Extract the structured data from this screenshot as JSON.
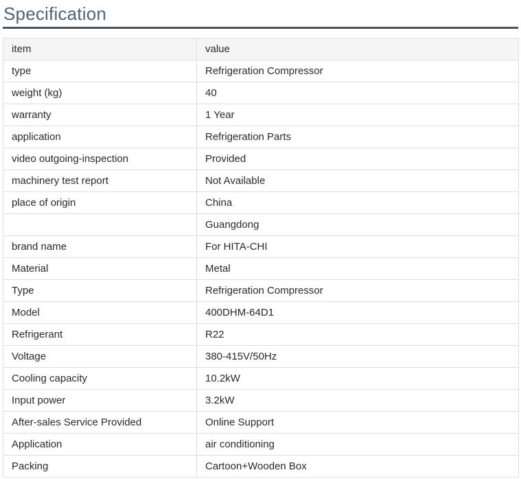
{
  "page": {
    "title": "Specification"
  },
  "colors": {
    "heading": "#4e6378",
    "heading_rule": "#4b5662",
    "header_bg": "#f5f5f6",
    "border_outer": "#d2d4d7",
    "border_inner": "#dcdee1",
    "text": "#26292e"
  },
  "table": {
    "headers": {
      "item": "item",
      "value": "value"
    },
    "rows": [
      {
        "item": "type",
        "value": "Refrigeration Compressor"
      },
      {
        "item": "weight (kg)",
        "value": "40"
      },
      {
        "item": "warranty",
        "value": "1 Year"
      },
      {
        "item": "application",
        "value": "Refrigeration Parts"
      },
      {
        "item": "video outgoing-inspection",
        "value": "Provided"
      },
      {
        "item": "machinery test report",
        "value": "Not Available"
      },
      {
        "item": "place of origin",
        "value": "China"
      },
      {
        "item": "",
        "value": "Guangdong"
      },
      {
        "item": "brand name",
        "value": "For HITA-CHI"
      },
      {
        "item": "Material",
        "value": "Metal"
      },
      {
        "item": "Type",
        "value": "Refrigeration Compressor"
      },
      {
        "item": "Model",
        "value": "400DHM-64D1"
      },
      {
        "item": "Refrigerant",
        "value": "R22"
      },
      {
        "item": "Voltage",
        "value": "380-415V/50Hz"
      },
      {
        "item": "Cooling capacity",
        "value": "10.2kW"
      },
      {
        "item": "Input power",
        "value": "3.2kW"
      },
      {
        "item": "After-sales Service Provided",
        "value": "Online Support"
      },
      {
        "item": "Application",
        "value": "air conditioning"
      },
      {
        "item": "Packing",
        "value": "Cartoon+Wooden Box"
      }
    ]
  }
}
